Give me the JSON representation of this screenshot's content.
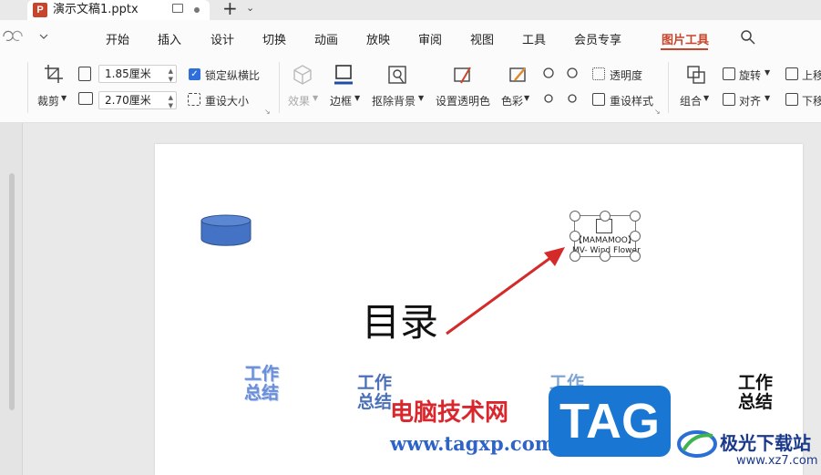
{
  "titlebar": {
    "file_name": "演示文稿1.pptx",
    "app_letter": "P",
    "new_tab": "+",
    "nav_chevron": "⌄"
  },
  "menu": {
    "items": [
      "开始",
      "插入",
      "设计",
      "切换",
      "动画",
      "放映",
      "审阅",
      "视图",
      "工具",
      "会员专享",
      "图片工具"
    ],
    "active": "图片工具",
    "accent": "#c8452b"
  },
  "ribbon": {
    "crop": "裁剪",
    "width_value": "1.85厘米",
    "height_value": "2.70厘米",
    "lock_ratio": "锁定纵横比",
    "reset_size": "重设大小",
    "effects": "效果",
    "border": "边框",
    "remove_bg": "抠除背景",
    "set_transparent": "设置透明色",
    "color": "色彩",
    "transparency": "透明度",
    "reset_style": "重设样式",
    "group": "组合",
    "rotate": "旋转",
    "align": "对齐",
    "move_up": "上移",
    "move_down": "下移"
  },
  "slide": {
    "toc_title": "目录",
    "wordart": [
      "工作\n总结",
      "工作\n总结",
      "工作\n总结",
      "工作\n总结"
    ],
    "object_label": "【MAMAMOO】\nMV- Wind Flower"
  },
  "watermark": {
    "site_name": "电脑技术网",
    "site_url": "www.tagxp.com",
    "tag": "TAG",
    "logo_name": "极光下载站",
    "logo_url": "www.xz7.com"
  }
}
